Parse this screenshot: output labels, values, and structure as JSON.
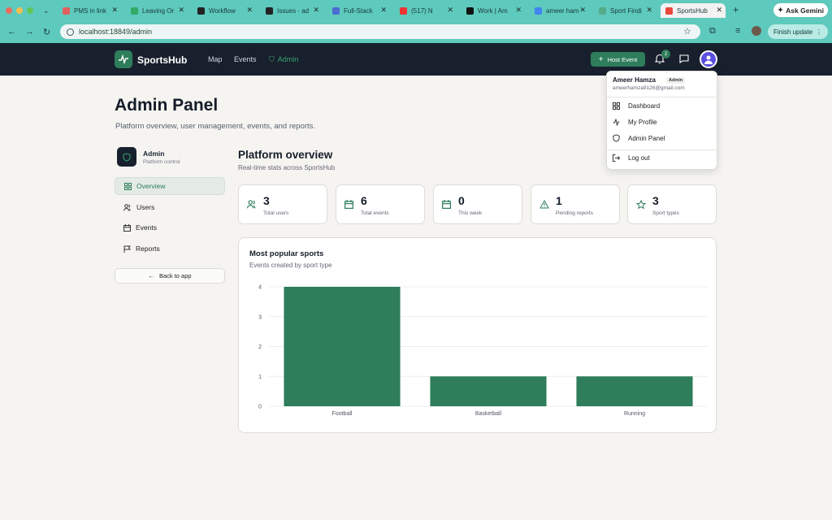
{
  "browser": {
    "tabs": [
      {
        "label": "PMS in link",
        "color": "#e06060"
      },
      {
        "label": "Leaving Or",
        "color": "#3a6"
      },
      {
        "label": "Workflow",
        "color": "#222"
      },
      {
        "label": "Issues · ad",
        "color": "#222"
      },
      {
        "label": "Full-Stack",
        "color": "#4a6cd4"
      },
      {
        "label": "(517) N",
        "color": "#e33"
      },
      {
        "label": "Work | Am",
        "color": "#111"
      },
      {
        "label": "ameer ham",
        "color": "#4285f4"
      },
      {
        "label": "Sport Findi",
        "color": "#5a8"
      },
      {
        "label": "SportsHub",
        "color": "#e8483c"
      }
    ],
    "gemini_label": "Ask Gemini",
    "url": "localhost:18849/admin",
    "update_label": "Finish update"
  },
  "header": {
    "brand": "SportsHub",
    "nav": [
      "Map",
      "Events",
      "Admin"
    ],
    "host_button": "Host Event",
    "notification_count": "2"
  },
  "page": {
    "title": "Admin Panel",
    "subtitle": "Platform overview, user management, events, and reports."
  },
  "sidebar": {
    "title": "Admin",
    "subtitle": "Platform control",
    "items": [
      "Overview",
      "Users",
      "Events",
      "Reports"
    ],
    "back_label": "Back to app"
  },
  "overview": {
    "title": "Platform overview",
    "subtitle": "Real-time stats across SportsHub",
    "stats": [
      {
        "value": "3",
        "label": "Total users",
        "icon": "users-icon"
      },
      {
        "value": "6",
        "label": "Total events",
        "icon": "calendar-icon"
      },
      {
        "value": "0",
        "label": "This week",
        "icon": "calendar-icon"
      },
      {
        "value": "1",
        "label": "Pending reports",
        "icon": "warning-icon"
      },
      {
        "value": "3",
        "label": "Sport types",
        "icon": "star-icon"
      }
    ]
  },
  "chart_card": {
    "title": "Most popular sports",
    "subtitle": "Events created by sport type"
  },
  "chart_data": {
    "type": "bar",
    "categories": [
      "Football",
      "Basketball",
      "Running"
    ],
    "values": [
      4,
      1,
      1
    ],
    "ylim": [
      0,
      4
    ],
    "yticks": [
      0,
      1,
      2,
      3,
      4
    ],
    "grid": true,
    "bar_color": "#2e7d5b"
  },
  "dropdown": {
    "name": "Ameer Hamza",
    "role": "Admin",
    "email": "ameerhamza9126@gmail.com",
    "items": [
      "Dashboard",
      "My Profile",
      "Admin Panel",
      "Log out"
    ]
  }
}
